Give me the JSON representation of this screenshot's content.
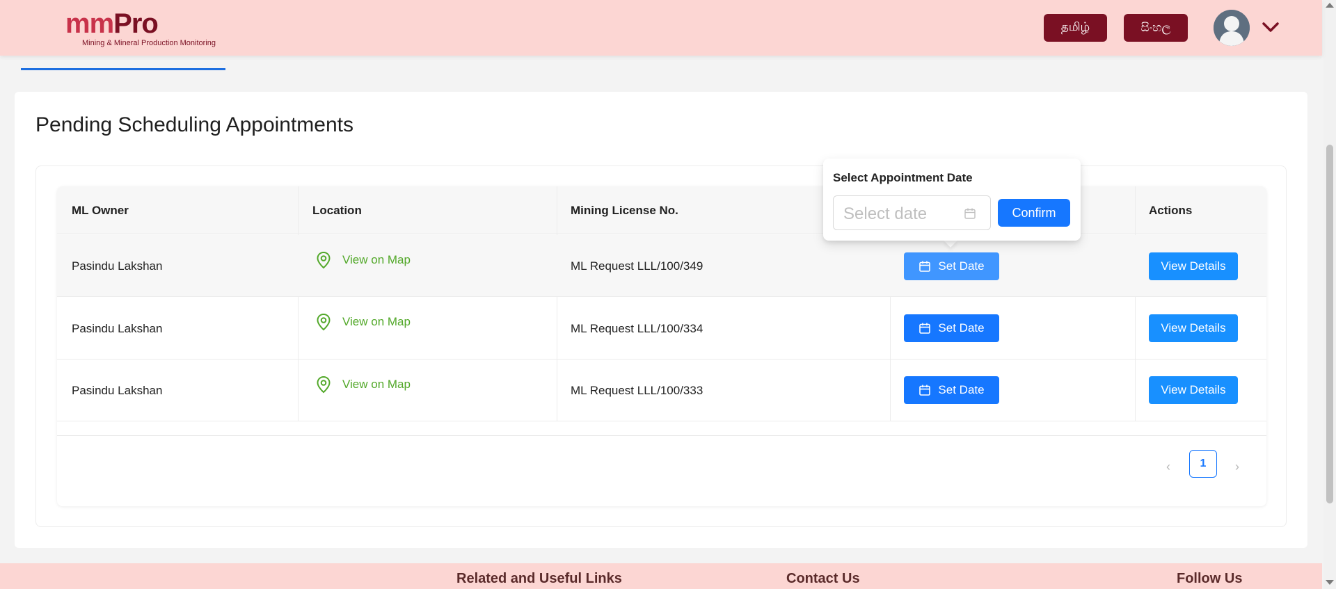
{
  "header": {
    "logo_main_a": "mm",
    "logo_main_b": "Pro",
    "logo_sub": "Mining & Mineral Production Monitoring",
    "lang_tamil": "தமிழ்",
    "lang_sinhala": "සිංහල",
    "avatar_icon": "user-avatar-icon",
    "menu_icon": "chevron-down-icon"
  },
  "page": {
    "title": "Pending Scheduling Appointments"
  },
  "table": {
    "columns": [
      "ML Owner",
      "Location",
      "Mining License No.",
      "",
      "Actions"
    ],
    "rows": [
      {
        "owner": "Pasindu Lakshan",
        "location": "View on Map",
        "license": "ML Request LLL/100/349",
        "set_date": "Set Date",
        "action": "View Details"
      },
      {
        "owner": "Pasindu Lakshan",
        "location": "View on Map",
        "license": "ML Request LLL/100/334",
        "set_date": "Set Date",
        "action": "View Details"
      },
      {
        "owner": "Pasindu Lakshan",
        "location": "View on Map",
        "license": "ML Request LLL/100/333",
        "set_date": "Set Date",
        "action": "View Details"
      }
    ]
  },
  "pagination": {
    "prev": "‹",
    "current": "1",
    "next": "›"
  },
  "popover": {
    "title": "Select Appointment Date",
    "placeholder": "Select date",
    "confirm": "Confirm"
  },
  "footer": {
    "links_heading": "Related and Useful Links",
    "contact_heading": "Contact Us",
    "follow_heading": "Follow Us"
  },
  "colors": {
    "header_bg": "#fcd6d3",
    "brand_dark": "#7a1023",
    "primary": "#1677ff",
    "map_green": "#52a829"
  }
}
